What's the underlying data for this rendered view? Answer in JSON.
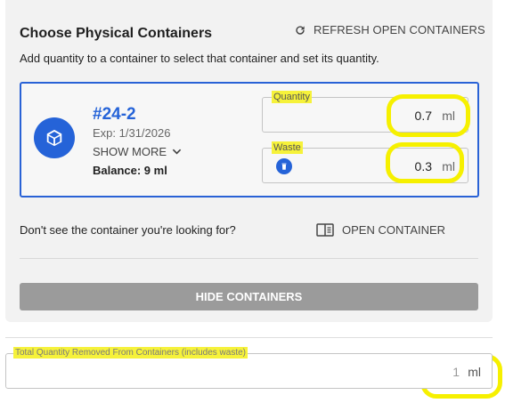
{
  "header": {
    "title": "Choose Physical Containers",
    "refresh_label": "REFRESH OPEN CONTAINERS",
    "instructions": "Add quantity to a container to select that container and set its quantity."
  },
  "container": {
    "id": "#24-2",
    "expiration": "Exp: 1/31/2026",
    "show_more_label": "SHOW MORE",
    "balance": "Balance: 9 ml",
    "icon": "package-icon",
    "quantity": {
      "label": "Quantity",
      "value": "0.7",
      "unit": "ml"
    },
    "waste": {
      "label": "Waste",
      "value": "0.3",
      "unit": "ml"
    }
  },
  "missing_prompt": "Don't see the container you're looking for?",
  "open_container_label": "OPEN CONTAINER",
  "hide_containers_label": "HIDE CONTAINERS",
  "total": {
    "label": "Total Quantity Removed From Containers (includes waste)",
    "value": "1",
    "unit": "ml"
  },
  "colors": {
    "accent": "#2563d8",
    "highlight": "#f6f000",
    "button_gray": "#9b9b9b"
  }
}
